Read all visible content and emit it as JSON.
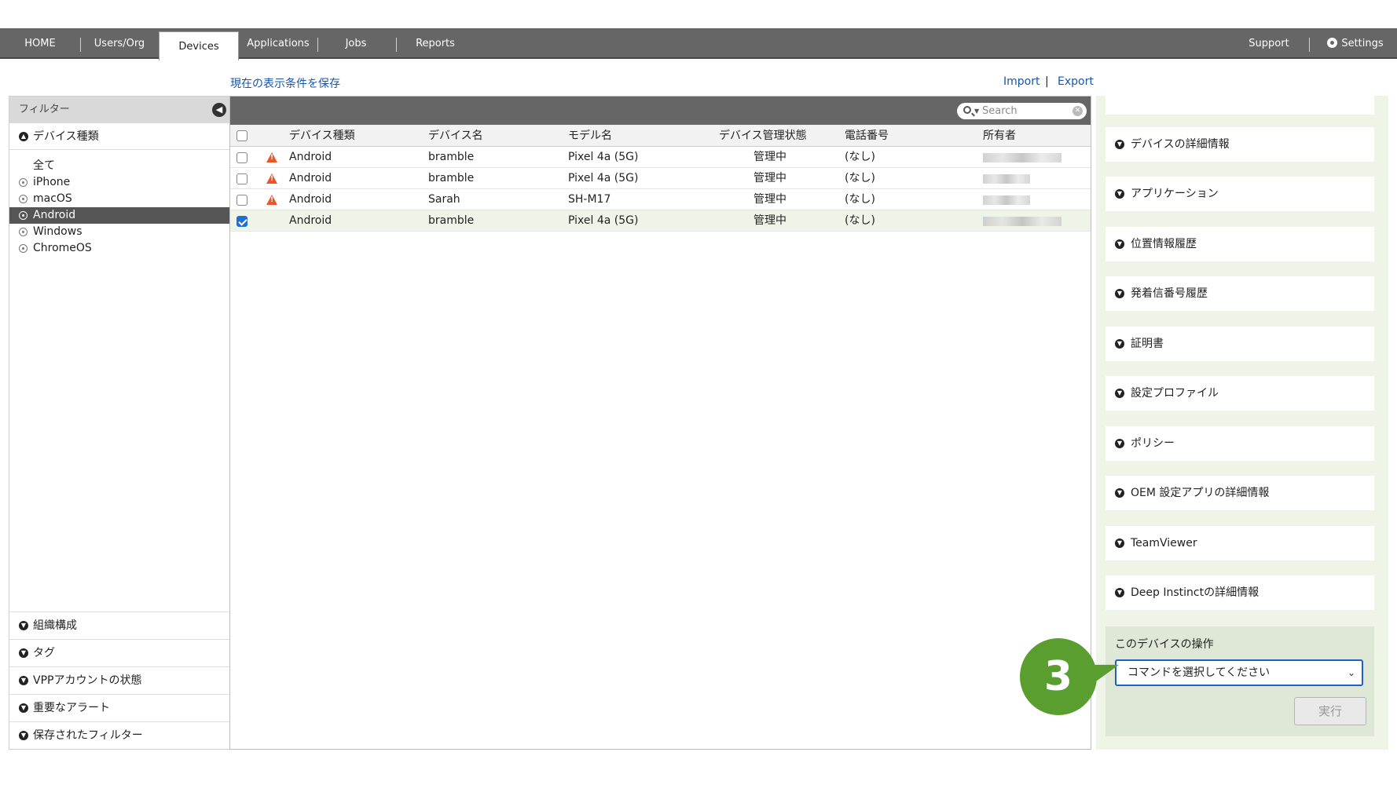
{
  "nav": {
    "tabs": [
      "HOME",
      "Users/Org",
      "Devices",
      "Applications",
      "Jobs",
      "Reports"
    ],
    "active": "Devices",
    "support": "Support",
    "settings": "Settings"
  },
  "toplinks": {
    "save_view": "現在の表示条件を保存",
    "import": "Import",
    "separator": "|",
    "export": "Export"
  },
  "filter": {
    "header": "フィルター",
    "device_type_label": "デバイス種類",
    "options": [
      "全て",
      "iPhone",
      "macOS",
      "Android",
      "Windows",
      "ChromeOS"
    ],
    "selected": "Android",
    "sections": [
      "組織構成",
      "タグ",
      "VPPアカウントの状態",
      "重要なアラート",
      "保存されたフィルター"
    ]
  },
  "search": {
    "placeholder": "Search"
  },
  "table": {
    "columns": [
      "デバイス種類",
      "デバイス名",
      "モデル名",
      "デバイス管理状態",
      "電話番号",
      "所有者"
    ],
    "rows": [
      {
        "type": "Android",
        "name": "bramble",
        "model": "Pixel 4a (5G)",
        "status": "管理中",
        "phone": "(なし)",
        "warning": true,
        "checked": false
      },
      {
        "type": "Android",
        "name": "bramble",
        "model": "Pixel 4a (5G)",
        "status": "管理中",
        "phone": "(なし)",
        "warning": true,
        "checked": false
      },
      {
        "type": "Android",
        "name": "Sarah",
        "model": "SH-M17",
        "status": "管理中",
        "phone": "(なし)",
        "warning": true,
        "checked": false
      },
      {
        "type": "Android",
        "name": "bramble",
        "model": "Pixel 4a (5G)",
        "status": "管理中",
        "phone": "(なし)",
        "warning": false,
        "checked": true
      }
    ]
  },
  "detail": {
    "sections": [
      "デバイスの詳細情報",
      "アプリケーション",
      "位置情報履歴",
      "発着信番号履歴",
      "証明書",
      "設定プロファイル",
      "ポリシー",
      "OEM 設定アプリの詳細情報",
      "TeamViewer",
      "Deep Instinctの詳細情報"
    ],
    "ops_title": "このデバイスの操作",
    "command_placeholder": "コマンドを選択してください",
    "execute": "実行"
  },
  "callout": {
    "number": "3"
  },
  "colors": {
    "nav": "#666666",
    "accent_blue": "#1a56a8",
    "callout_green": "#5a9e2f",
    "warning": "#e8562a"
  }
}
